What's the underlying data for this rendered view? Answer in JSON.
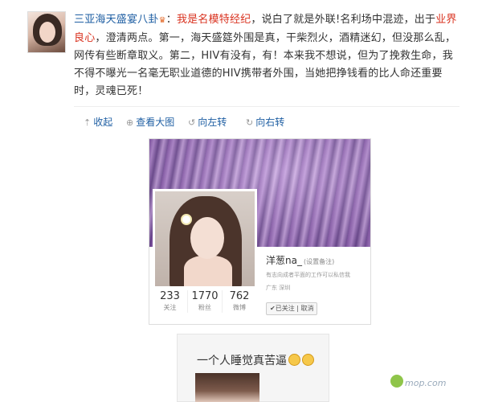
{
  "post": {
    "author": "三亚海天盛宴八卦",
    "colon": "：",
    "part_red1": "我是名模特经纪",
    "part_black1": "，说白了就是外联!名利场中混迹，出于",
    "part_red2": "业界良心",
    "part_black2": "，澄清两点。第一，海天盛筵外围是真，干柴烈火，酒精迷幻，但没那么乱，网传有些断章取义。第二，HIV有没有，有！本来我不想说，但为了挽救生命，我不得不曝光一名毫无职业道德的HIV携带者外围，当她把挣钱看的比人命还重要时，灵魂已死！"
  },
  "toolbar": {
    "collect": "收起",
    "view_large": "查看大图",
    "rotate_left": "向左转",
    "rotate_right": "向右转"
  },
  "profile": {
    "name": "洋葱na_",
    "remark": "(设置备注)",
    "bio": "有志向成者平面的工作可以私信我",
    "location": "广东 深圳",
    "follow_btn": "✔已关注 | 取消",
    "cancel_btn": "",
    "stats": [
      {
        "value": "233",
        "label": "关注"
      },
      {
        "value": "1770",
        "label": "粉丝"
      },
      {
        "value": "762",
        "label": "微博"
      }
    ]
  },
  "card2": {
    "text": "一个人睡觉真苦逼"
  },
  "watermark": {
    "text": "mop.com"
  }
}
